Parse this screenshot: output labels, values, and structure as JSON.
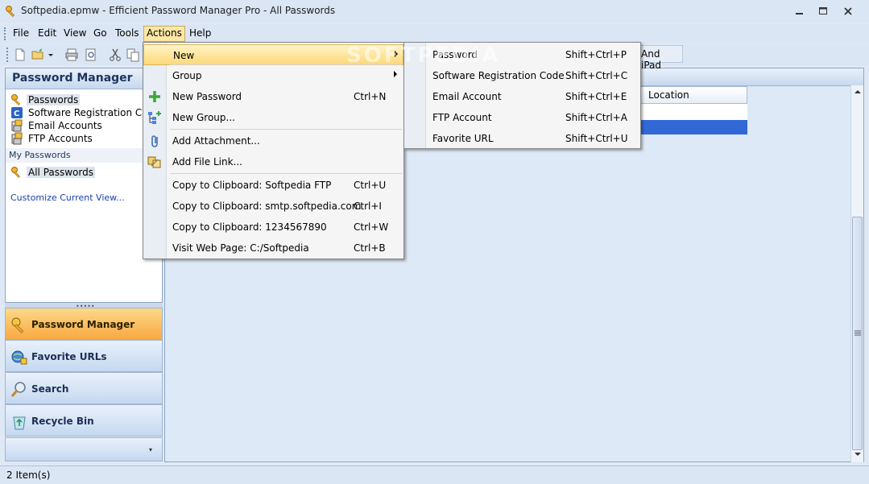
{
  "window": {
    "title": "Softpedia.epmw - Efficient Password Manager Pro - All Passwords"
  },
  "menubar": {
    "items": [
      {
        "label": "File"
      },
      {
        "label": "Edit"
      },
      {
        "label": "View"
      },
      {
        "label": "Go"
      },
      {
        "label": "Tools"
      },
      {
        "label": "Actions"
      },
      {
        "label": "Help"
      }
    ]
  },
  "sidebar": {
    "header": "Password Manager",
    "tree": [
      {
        "label": "Passwords",
        "icon": "key-icon"
      },
      {
        "label": "Software Registration Code",
        "icon": "registration-code-icon"
      },
      {
        "label": "Email Accounts",
        "icon": "email-icon"
      },
      {
        "label": "FTP Accounts",
        "icon": "ftp-icon"
      }
    ],
    "group_label": "My Passwords",
    "group_item": "All Passwords",
    "customize_link": "Customize Current View...",
    "splitter_grip": "•••••"
  },
  "navigation": {
    "buttons": [
      {
        "label": "Password Manager",
        "icon": "key-icon",
        "active": true
      },
      {
        "label": "Favorite URLs",
        "icon": "globe-lock-icon",
        "active": false
      },
      {
        "label": "Search",
        "icon": "magnifier-icon",
        "active": false
      },
      {
        "label": "Recycle Bin",
        "icon": "recycle-bin-icon",
        "active": false
      }
    ],
    "footer_arrow": "▾"
  },
  "main": {
    "tab_partial": "And iPad",
    "column_header": "Location"
  },
  "actions_menu": {
    "items": [
      {
        "label": "New",
        "shortcut": "",
        "submenu": true,
        "icon": ""
      },
      {
        "label": "Group",
        "shortcut": "",
        "submenu": true,
        "icon": ""
      },
      {
        "label": "New Password",
        "shortcut": "Ctrl+N",
        "submenu": false,
        "icon": "plus-icon"
      },
      {
        "label": "New Group...",
        "shortcut": "",
        "submenu": false,
        "icon": "new-group-icon"
      },
      {
        "label": "Add Attachment...",
        "shortcut": "",
        "submenu": false,
        "icon": "paperclip-icon"
      },
      {
        "label": "Add File Link...",
        "shortcut": "",
        "submenu": false,
        "icon": "file-link-icon"
      },
      {
        "label": "Copy to Clipboard: Softpedia FTP",
        "shortcut": "Ctrl+U",
        "submenu": false,
        "icon": ""
      },
      {
        "label": "Copy to Clipboard: smtp.softpedia.com",
        "shortcut": "Ctrl+I",
        "submenu": false,
        "icon": ""
      },
      {
        "label": "Copy to Clipboard: 1234567890",
        "shortcut": "Ctrl+W",
        "submenu": false,
        "icon": ""
      },
      {
        "label": "Visit Web Page: C:/Softpedia",
        "shortcut": "Ctrl+B",
        "submenu": false,
        "icon": ""
      }
    ]
  },
  "new_submenu": {
    "items": [
      {
        "label": "Password",
        "shortcut": "Shift+Ctrl+P"
      },
      {
        "label": "Software Registration Code",
        "shortcut": "Shift+Ctrl+C"
      },
      {
        "label": "Email Account",
        "shortcut": "Shift+Ctrl+E"
      },
      {
        "label": "FTP Account",
        "shortcut": "Shift+Ctrl+A"
      },
      {
        "label": "Favorite URL",
        "shortcut": "Shift+Ctrl+U"
      }
    ]
  },
  "watermark": "SOFTPEDIA",
  "statusbar": {
    "text": "2 Item(s)"
  },
  "colors": {
    "accent": "#3168d5",
    "highlight": "#fcd978",
    "chrome": "#dbe6f4"
  }
}
